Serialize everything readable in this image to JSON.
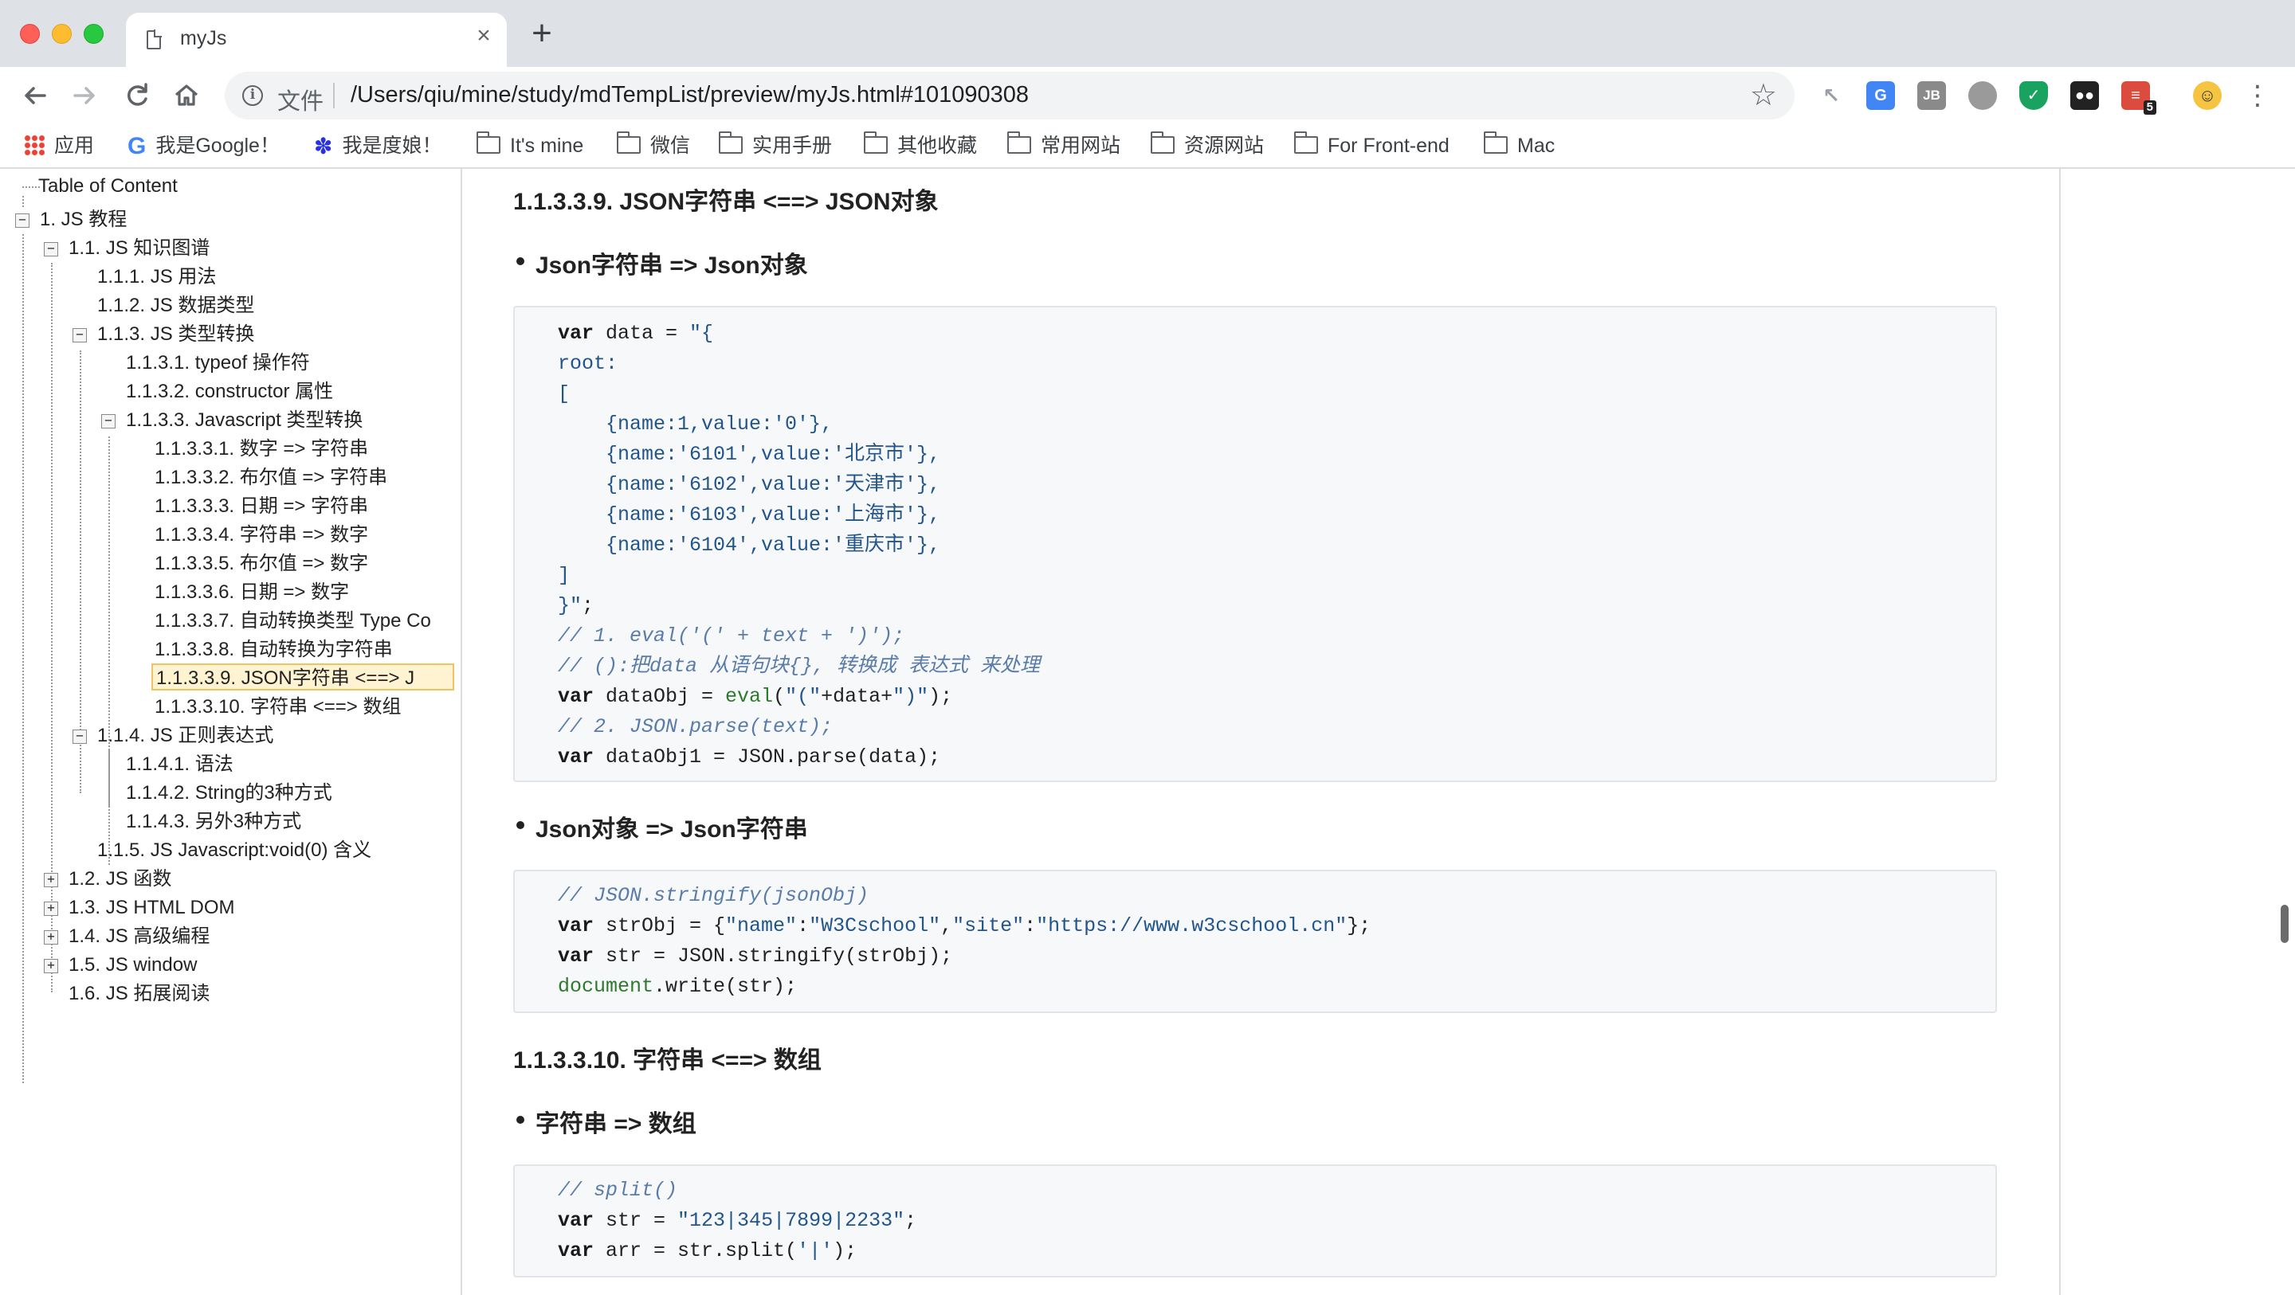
{
  "browser": {
    "tab_title": "myJs",
    "tab_close": "×",
    "new_tab": "+",
    "omnibox_file_label": "文件",
    "url": "/Users/qiu/mine/study/mdTempList/preview/myJs.html#101090308",
    "ext_badge": "5",
    "ext_jb_label": "JB"
  },
  "bookmarks": [
    {
      "label": "应用",
      "icon": "apps-icon"
    },
    {
      "label": "我是Google！",
      "icon": "google-icon"
    },
    {
      "label": "我是度娘！",
      "icon": "baidu-icon"
    },
    {
      "label": "It's mine",
      "icon": "folder-icon"
    },
    {
      "label": "微信",
      "icon": "folder-icon"
    },
    {
      "label": "实用手册",
      "icon": "folder-icon"
    },
    {
      "label": "其他收藏",
      "icon": "folder-icon"
    },
    {
      "label": "常用网站",
      "icon": "folder-icon"
    },
    {
      "label": "资源网站",
      "icon": "folder-icon"
    },
    {
      "label": "For Front-end",
      "icon": "folder-icon"
    },
    {
      "label": "Mac",
      "icon": "folder-icon"
    }
  ],
  "toc": {
    "title": "Table of Content",
    "toggle_expanded": "−",
    "toggle_collapsed": "+",
    "items": [
      "1. JS 教程",
      "1.1. JS 知识图谱",
      "1.1.1. JS 用法",
      "1.1.2. JS 数据类型",
      "1.1.3. JS 类型转换",
      "1.1.3.1. typeof 操作符",
      "1.1.3.2. constructor 属性",
      "1.1.3.3. Javascript 类型转换",
      "1.1.3.3.1. 数字 => 字符串",
      "1.1.3.3.2. 布尔值 => 字符串",
      "1.1.3.3.3. 日期 => 字符串",
      "1.1.3.3.4. 字符串 => 数字",
      "1.1.3.3.5. 布尔值 => 数字",
      "1.1.3.3.6. 日期 => 数字",
      "1.1.3.3.7. 自动转换类型 Type Co",
      "1.1.3.3.8. 自动转换为字符串",
      "1.1.3.3.9. JSON字符串 <==> J",
      "1.1.3.3.10. 字符串 <==> 数组",
      "1.1.4. JS 正则表达式",
      "1.1.4.1. 语法",
      "1.1.4.2. String的3种方式",
      "1.1.4.3. 另外3种方式",
      "1.1.5. JS Javascript:void(0) 含义",
      "1.2. JS 函数",
      "1.3. JS HTML DOM",
      "1.4. JS 高级编程",
      "1.5. JS window",
      "1.6. JS 拓展阅读"
    ]
  },
  "content": {
    "h_json": "1.1.3.3.9. JSON字符串 <==> JSON对象",
    "b_str_to_obj": "Json字符串 => Json对象",
    "code1": [
      "var data = \"{",
      "root:",
      "[",
      "    {name:1,value:'0'},",
      "    {name:'6101',value:'北京市'},",
      "    {name:'6102',value:'天津市'},",
      "    {name:'6103',value:'上海市'},",
      "    {name:'6104',value:'重庆市'},",
      "]",
      "}\";",
      "// 1. eval('(' + text + ')');",
      "// ():把data 从语句块{}, 转换成 表达式 来处理",
      "var dataObj = eval(\"(\"+data+\")\");",
      "// 2. JSON.parse(text);",
      "var dataObj1 = JSON.parse(data);"
    ],
    "b_obj_to_str": "Json对象 => Json字符串",
    "code2": [
      "// JSON.stringify(jsonObj)",
      "var strObj = {\"name\":\"W3Cschool\",\"site\":\"https://www.w3cschool.cn\"};",
      "var str = JSON.stringify(strObj);",
      "document.write(str);"
    ],
    "h_split": "1.1.3.3.10. 字符串 <==> 数组",
    "b_str_to_arr": "字符串 => 数组",
    "code3": [
      "// split()",
      "var str = \"123|345|7899|2233\";",
      "var arr = str.split('|');"
    ]
  }
}
